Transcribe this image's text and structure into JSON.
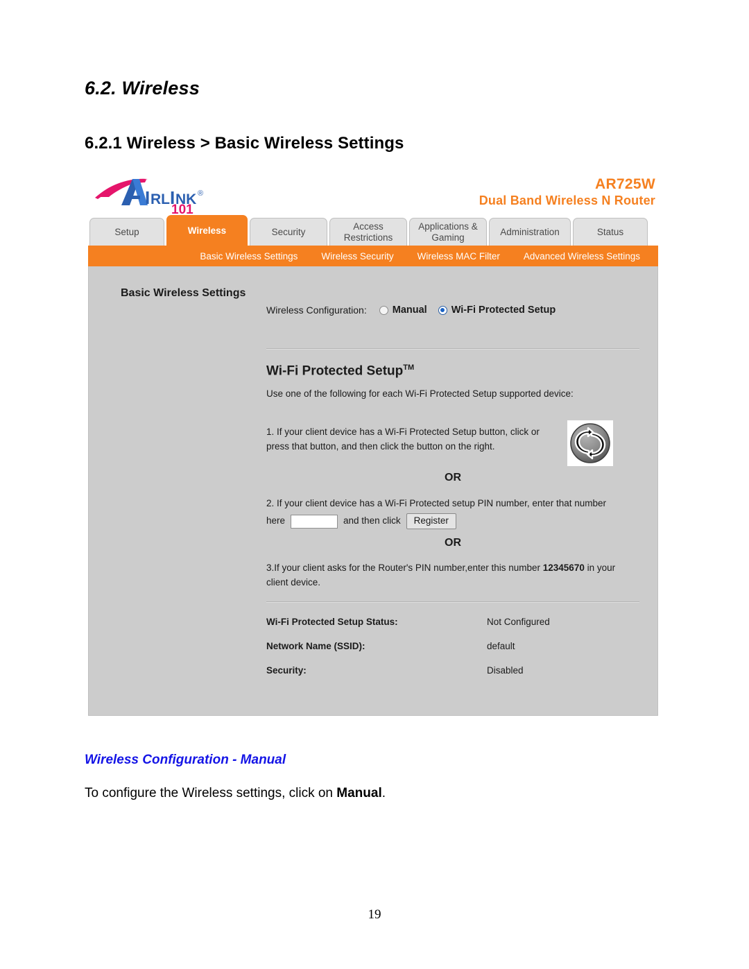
{
  "document": {
    "heading": "6.2. Wireless",
    "subheading": "6.2.1 Wireless > Basic Wireless Settings",
    "caption": "Wireless Configuration - Manual",
    "body_text_prefix": "To configure the Wireless settings, click on ",
    "body_text_bold": "Manual",
    "body_text_suffix": ".",
    "page_number": "19"
  },
  "router_ui": {
    "brand": {
      "name": "AIRLINK",
      "suffix": "101",
      "registered_mark": "®"
    },
    "model": {
      "name": "AR725W",
      "description": "Dual Band Wireless N Router",
      "color": "#F58020"
    },
    "tabs": [
      {
        "label": "Setup",
        "active": false
      },
      {
        "label": "Wireless",
        "active": true
      },
      {
        "label": "Security",
        "active": false
      },
      {
        "label": "Access Restrictions",
        "active": false
      },
      {
        "label": "Applications & Gaming",
        "active": false
      },
      {
        "label": "Administration",
        "active": false
      },
      {
        "label": "Status",
        "active": false
      }
    ],
    "subnav": [
      {
        "label": "Basic Wireless Settings",
        "active": true
      },
      {
        "label": "Wireless Security",
        "active": false
      },
      {
        "label": "Wireless MAC Filter",
        "active": false
      },
      {
        "label": "Advanced Wireless Settings",
        "active": false
      }
    ],
    "content": {
      "section_title": "Basic Wireless Settings",
      "config_label": "Wireless Configuration:",
      "options": [
        {
          "label": "Manual",
          "selected": false
        },
        {
          "label": "Wi-Fi Protected Setup",
          "selected": true
        }
      ],
      "wps_title": "Wi-Fi Protected Setup",
      "wps_title_sup": "TM",
      "wps_intro": "Use one of the following for each Wi-Fi Protected Setup supported device:",
      "step1": "1. If your client device has a Wi-Fi Protected Setup button, click or press that button, and then click the button on the right.",
      "or_1": "OR",
      "step2_line1": "2. If your client device has a Wi-Fi Protected setup PIN number, enter that number",
      "step2_here": "here",
      "step2_and_click": "and then click",
      "register_button": "Register",
      "pin_input_value": "",
      "or_2": "OR",
      "step3_prefix": "3.If your client asks for the Router's PIN number,enter this number ",
      "step3_pin": "12345670",
      "step3_suffix": " in your client device.",
      "status": [
        {
          "key": "Wi-Fi Protected Setup Status:",
          "value": "Not Configured"
        },
        {
          "key": "Network Name (SSID):",
          "value": "default"
        },
        {
          "key": "Security:",
          "value": "Disabled"
        }
      ]
    }
  }
}
